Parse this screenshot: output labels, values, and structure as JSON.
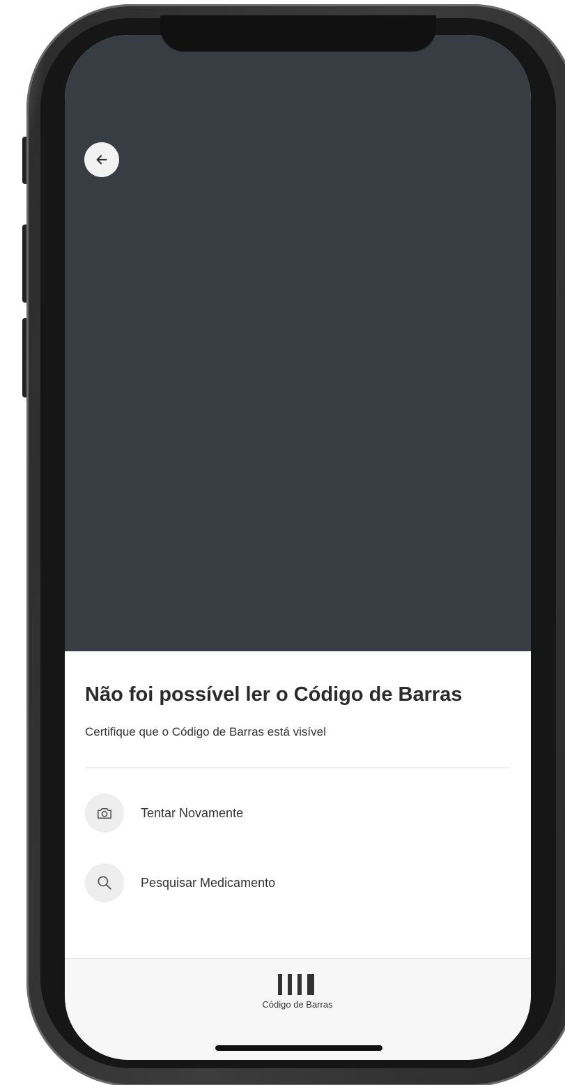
{
  "camera": {
    "back_icon": "arrow-left-icon",
    "background_color": "#383c43"
  },
  "sheet": {
    "title": "Não foi possível ler o Código de Barras",
    "subtitle": "Certifique que o Código de Barras está visível",
    "actions": [
      {
        "label": "Tentar Novamente",
        "icon": "camera-icon"
      },
      {
        "label": "Pesquisar Medicamento",
        "icon": "search-icon"
      }
    ]
  },
  "tabbar": {
    "items": [
      {
        "label": "Código de Barras",
        "icon": "barcode-icon"
      }
    ]
  }
}
